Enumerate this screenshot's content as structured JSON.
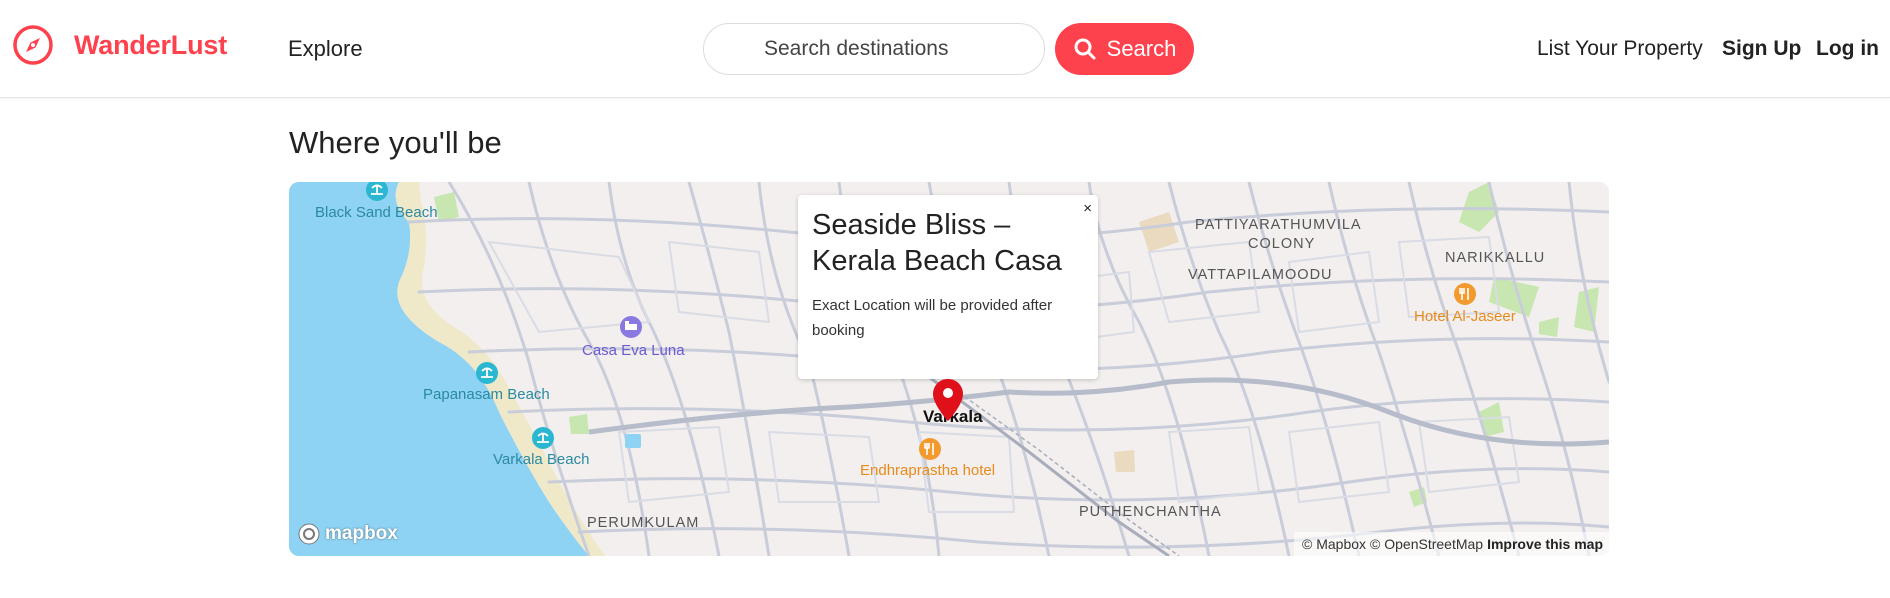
{
  "navbar": {
    "brand_name": "WanderLust",
    "explore_label": "Explore",
    "search_placeholder": "Search destinations",
    "search_button_label": "Search",
    "list_property_label": "List Your Property",
    "signup_label": "Sign Up",
    "login_label": "Log in",
    "brand_color": "#fe424d"
  },
  "section": {
    "title": "Where you'll be"
  },
  "map": {
    "popup": {
      "title": "Seaside Bliss – Kerala Beach Casa",
      "text": "Exact Location will be provided after booking",
      "close_label": "×"
    },
    "labels": {
      "black_sand_beach": "Black Sand Beach",
      "casa_eva_luna": "Casa Eva Luna",
      "papanasam_beach": "Papanasam Beach",
      "varkala_beach": "Varkala Beach",
      "perumkulam": "PERUMKULAM",
      "varkala": "Varkala",
      "endhraprastha": "Endhraprastha hotel",
      "puthenchantha": "PUTHENCHANTHA",
      "pattiyarathumvila": "PATTIYARATHUMVILA",
      "colony": "COLONY",
      "vattapilamoodu": "VATTAPILAMOODU",
      "narikkallu": "NARIKKALLU",
      "hotel_al_jaseer": "Hotel Al-Jaseer"
    },
    "logo_text": "mapbox",
    "attribution": {
      "mapbox": "© Mapbox",
      "osm": "© OpenStreetMap",
      "improve": "Improve this map"
    },
    "colors": {
      "water": "#8fd3f4",
      "land": "#f2efee",
      "road": "#c9cdda",
      "park": "#c8e6b0",
      "marker": "#e0101a"
    }
  }
}
